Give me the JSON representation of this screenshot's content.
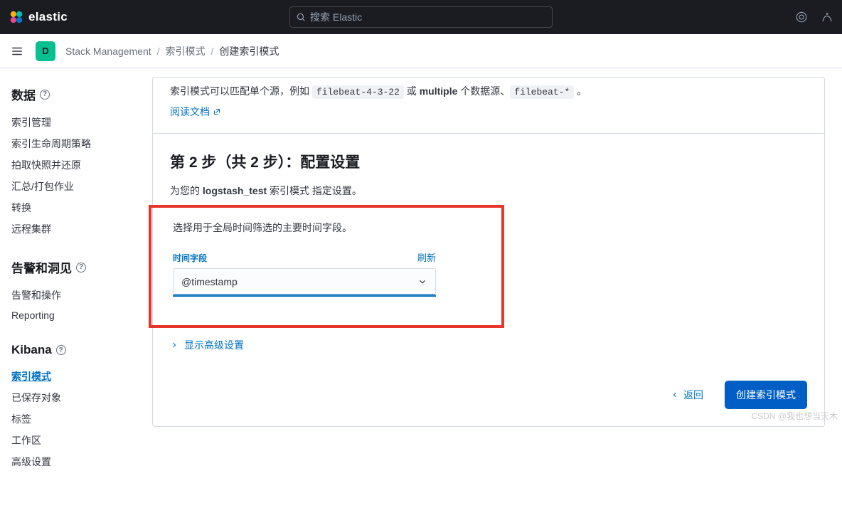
{
  "header": {
    "brand": "elastic",
    "search_placeholder": "搜索 Elastic"
  },
  "subheader": {
    "avatar_letter": "D",
    "breadcrumb": [
      "Stack Management",
      "索引模式",
      "创建索引模式"
    ]
  },
  "sidebar": {
    "groups": [
      {
        "title": "数据",
        "items": [
          "索引管理",
          "索引生命周期策略",
          "拍取快照并还原",
          "汇总/打包作业",
          "转换",
          "远程集群"
        ]
      },
      {
        "title": "告警和洞见",
        "items": [
          "告警和操作",
          "Reporting"
        ]
      },
      {
        "title": "Kibana",
        "items": [
          "索引模式",
          "已保存对象",
          "标签",
          "工作区",
          "高级设置"
        ],
        "active_index": 0
      }
    ]
  },
  "main": {
    "intro_prefix": "索引模式可以匹配单个源，例如 ",
    "code1": "filebeat-4-3-22",
    "intro_mid": " 或 ",
    "bold": "multiple",
    "intro_mid2": " 个数据源、",
    "code2": "filebeat-*",
    "intro_suffix": " 。",
    "doc_link": "阅读文档",
    "step_title": "第 2 步（共 2 步）：配置设置",
    "specify_prefix": "为您的 ",
    "pattern_name": "logstash_test",
    "specify_suffix": " 索引模式 指定设置。",
    "time_desc": "选择用于全局时间筛选的主要时间字段。",
    "field_label": "时间字段",
    "refresh": "刷新",
    "field_value": "@timestamp",
    "advanced": "显示高级设置",
    "back": "返回",
    "create": "创建索引模式"
  },
  "watermark": "CSDN @我也想当天木"
}
